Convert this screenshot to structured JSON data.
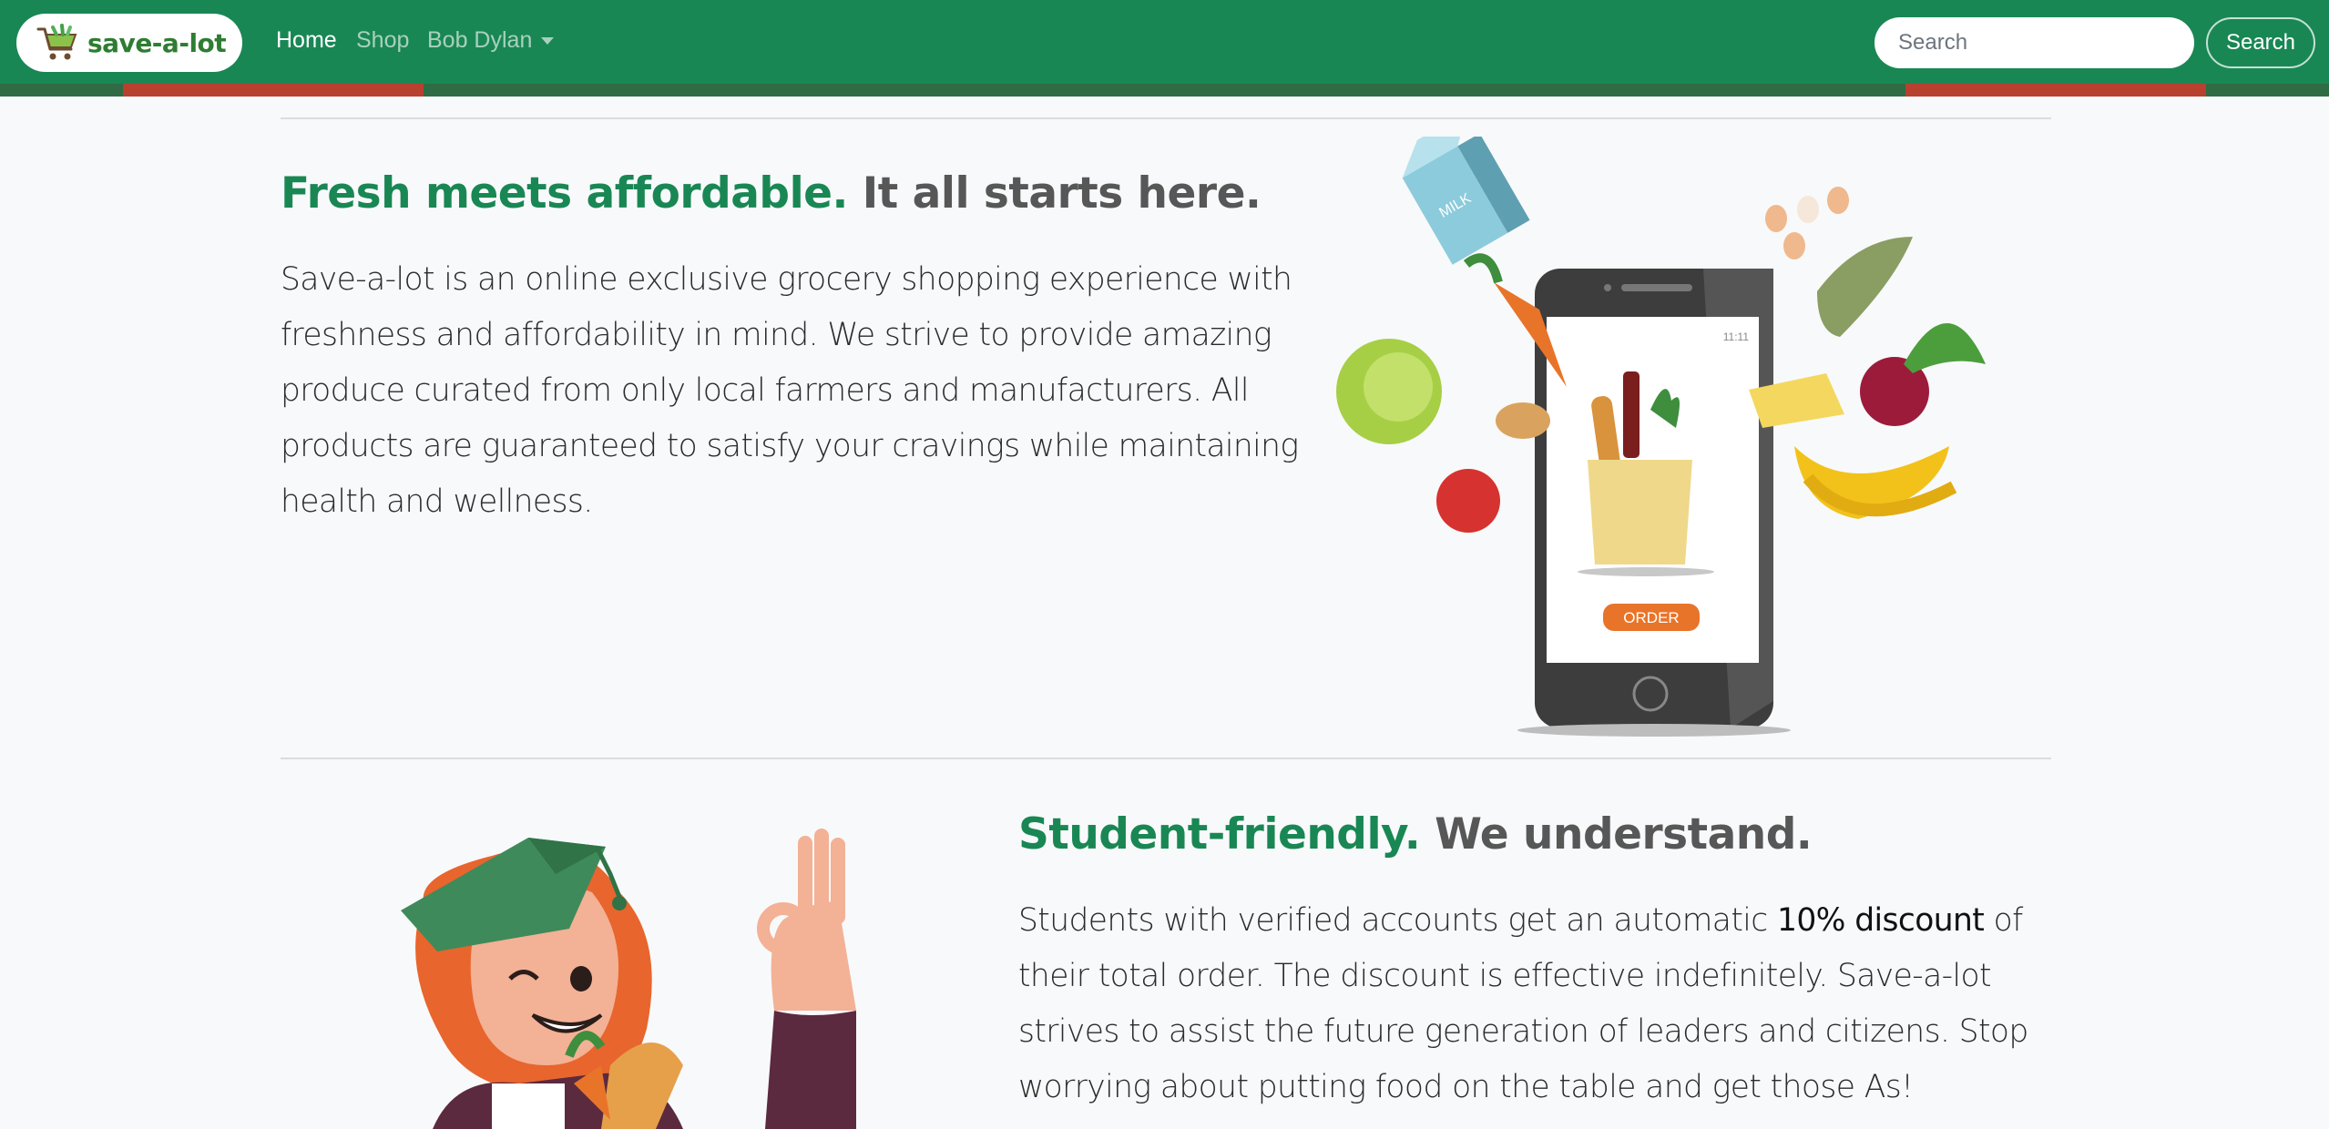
{
  "navbar": {
    "brand_name": "save-a-lot",
    "links": [
      {
        "label": "Home",
        "active": true
      },
      {
        "label": "Shop",
        "active": false
      },
      {
        "label": "Bob Dylan",
        "active": false
      }
    ],
    "search": {
      "placeholder": "Search",
      "value": "",
      "button_label": "Search"
    },
    "colors": {
      "primary": "#198754"
    }
  },
  "feature1": {
    "heading_accent": "Fresh meets affordable.",
    "heading_rest": "It all starts here.",
    "body": "Save-a-lot is an online exclusive grocery shopping experience with freshness and affordability in mind. We strive to provide amazing produce curated from only local farmers and manufacturers. All products are guaranteed to satisfy your cravings while maintaining health and wellness.",
    "illustration": {
      "milk_label": "MILK",
      "status_time": "11:11",
      "order_label": "ORDER"
    }
  },
  "feature2": {
    "heading_accent": "Student-friendly.",
    "heading_rest": "We understand.",
    "body_before": "Students with verified accounts get an automatic ",
    "body_strong": "10% discount",
    "body_after": " of their total order. The discount is effective indefinitely. Save-a-lot strives to assist the future generation of leaders and citizens. Stop worrying about putting food on the table and get those As!"
  }
}
